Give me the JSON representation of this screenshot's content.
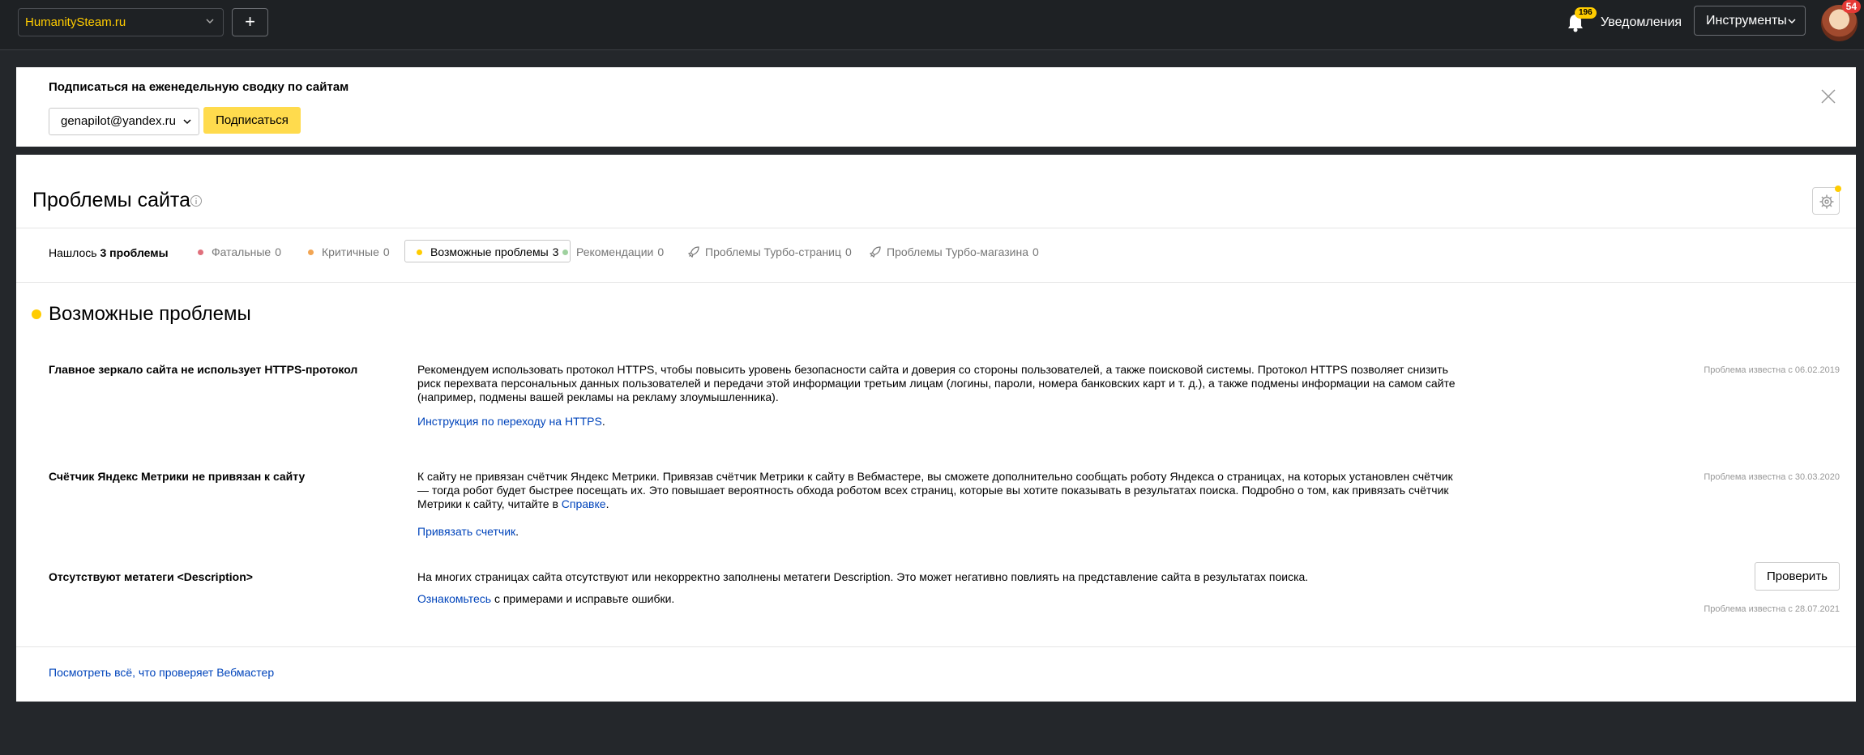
{
  "topbar": {
    "site": "HumanitySteam.ru",
    "add_label": "+",
    "notifications_count": "196",
    "notifications_label": "Уведомления",
    "tools_label": "Инструменты",
    "avatar_badge": "54"
  },
  "subscribe": {
    "title": "Подписаться на еженедельную сводку по сайтам",
    "email": "genapilot@yandex.ru",
    "button": "Подписаться"
  },
  "page": {
    "title": "Проблемы сайта",
    "found_prefix": "Нашлось ",
    "found_count": "3 проблемы",
    "filters": [
      {
        "label": "Фатальные",
        "count": "0",
        "color": "#e0707c"
      },
      {
        "label": "Критичные",
        "count": "0",
        "color": "#f2a553"
      },
      {
        "label": "Возможные проблемы",
        "count": "3",
        "color": "#ffcc00"
      },
      {
        "label": "Рекомендации",
        "count": "0",
        "color": "#9fd19f"
      },
      {
        "label": "Проблемы Турбо-страниц",
        "count": "0",
        "icon": "rocket-icon"
      },
      {
        "label": "Проблемы Турбо-магазина",
        "count": "0",
        "icon": "rocket-icon"
      }
    ],
    "section_title": "Возможные проблемы",
    "problems": [
      {
        "title": "Главное зеркало сайта не использует HTTPS-протокол",
        "description": "Рекомендуем использовать протокол HTTPS, чтобы повысить уровень безопасности сайта и доверия со стороны пользователей, а также поисковой системы. Протокол HTTPS позволяет снизить риск перехвата персональных данных пользователей и передачи этой информации третьим лицам (логины, пароли, номера банковских карт и т. д.), а также подмены информации на самом сайте (например, подмены вашей рекламы на рекламу злоумышленника).",
        "link": "Инструкция по переходу на HTTPS",
        "link_suffix": ".",
        "date": "Проблема известна с 06.02.2019"
      },
      {
        "title": "Счётчик Яндекс Метрики не привязан к сайту",
        "description_start": "К сайту не привязан счётчик Яндекс Метрики. Привязав счётчик Метрики к сайту в Вебмастере, вы сможете дополнительно сообщать роботу Яндекса о страницах, на которых установлен счётчик — тогда робот будет быстрее посещать их. Это повышает вероятность обхода роботом всех страниц, которые вы хотите показывать в результатах поиска. Подробно о том, как привязать счётчик Метрики к сайту, читайте в ",
        "description_link": "Справке",
        "description_end": ".",
        "link": "Привязать счетчик",
        "link_suffix": ".",
        "date": "Проблема известна с 30.03.2020"
      },
      {
        "title": "Отсутствуют метатеги <Description>",
        "description": "На многих страницах сайта отсутствуют или некорректно заполнены метатеги Description. Это может негативно повлиять на представление сайта в результатах поиска.",
        "link": "Ознакомьтесь",
        "link_suffix": " с примерами и исправьте ошибки.",
        "button": "Проверить",
        "date": "Проблема известна с 28.07.2021"
      }
    ],
    "footer_link": "Посмотреть всё, что проверяет Вебмастер"
  }
}
